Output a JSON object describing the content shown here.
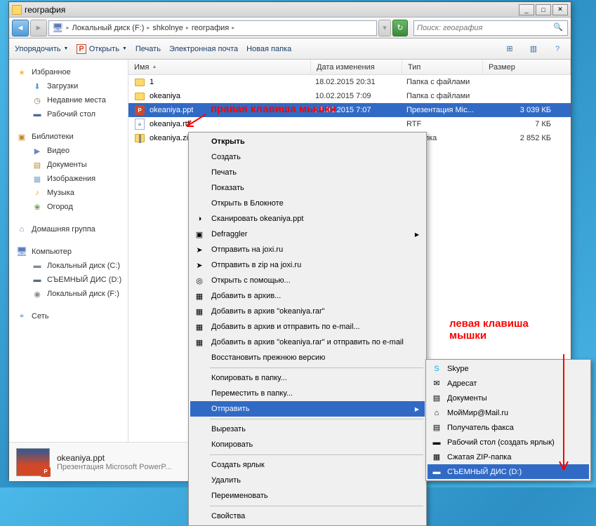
{
  "window": {
    "title": "география"
  },
  "breadcrumbs": [
    "Локальный диск (F:)",
    "shkolnye",
    "география"
  ],
  "search": {
    "placeholder": "Поиск: география"
  },
  "toolbar": {
    "organize": "Упорядочить",
    "open": "Открыть",
    "print": "Печать",
    "email": "Электронная почта",
    "newfolder": "Новая папка"
  },
  "columns": {
    "name": "Имя",
    "date": "Дата изменения",
    "type": "Тип",
    "size": "Размер"
  },
  "sidebar": {
    "favorites": {
      "label": "Избранное",
      "items": [
        "Загрузки",
        "Недавние места",
        "Рабочий стол"
      ]
    },
    "libraries": {
      "label": "Библиотеки",
      "items": [
        "Видео",
        "Документы",
        "Изображения",
        "Музыка",
        "Огород"
      ]
    },
    "homegroup": {
      "label": "Домашняя группа"
    },
    "computer": {
      "label": "Компьютер",
      "items": [
        "Локальный диск (С:)",
        "СЪЕМНЫЙ ДИС (D:)",
        "Локальный диск (F:)"
      ]
    },
    "network": {
      "label": "Сеть"
    }
  },
  "files": [
    {
      "name": "1",
      "date": "18.02.2015 20:31",
      "type": "Папка с файлами",
      "size": ""
    },
    {
      "name": "okeaniya",
      "date": "10.02.2015 7:09",
      "type": "Папка с файлами",
      "size": ""
    },
    {
      "name": "okeaniya.ppt",
      "date": "16.02.2015 7:07",
      "type": "Презентация Mic...",
      "size": "3 039 КБ"
    },
    {
      "name": "okeaniya.rtf",
      "date": "",
      "type": "RTF",
      "size": "7 КБ"
    },
    {
      "name": "okeaniya.zip",
      "date": "",
      "type": "IP-папка",
      "size": "2 852 КБ"
    }
  ],
  "context_menu": [
    {
      "label": "Открыть",
      "bold": true
    },
    {
      "label": "Создать"
    },
    {
      "label": "Печать"
    },
    {
      "label": "Показать"
    },
    {
      "label": "Открыть в Блокноте"
    },
    {
      "label": "Сканировать okeaniya.ppt",
      "icon": "◑"
    },
    {
      "label": "Defraggler",
      "icon": "▣",
      "submenu": true
    },
    {
      "label": "Отправить на joxi.ru",
      "icon": "➤"
    },
    {
      "label": "Отправить в zip на joxi.ru",
      "icon": "➤"
    },
    {
      "label": "Открыть с помощью...",
      "icon": "◎"
    },
    {
      "label": "Добавить в архив...",
      "icon": "▦"
    },
    {
      "label": "Добавить в архив \"okeaniya.rar\"",
      "icon": "▦"
    },
    {
      "label": "Добавить в архив и отправить по e-mail...",
      "icon": "▦"
    },
    {
      "label": "Добавить в архив \"okeaniya.rar\" и отправить по e-mail",
      "icon": "▦"
    },
    {
      "label": "Восстановить прежнюю версию"
    },
    {
      "sep": true
    },
    {
      "label": "Копировать в папку..."
    },
    {
      "label": "Переместить в папку..."
    },
    {
      "label": "Отправить",
      "submenu": true,
      "highlight": true
    },
    {
      "sep": true
    },
    {
      "label": "Вырезать"
    },
    {
      "label": "Копировать"
    },
    {
      "sep": true
    },
    {
      "label": "Создать ярлык"
    },
    {
      "label": "Удалить"
    },
    {
      "label": "Переименовать"
    },
    {
      "sep": true
    },
    {
      "label": "Свойства"
    }
  ],
  "sendto_menu": [
    {
      "label": "Skype",
      "icon": "S",
      "color": "#00aff0"
    },
    {
      "label": "Адресат",
      "icon": "✉"
    },
    {
      "label": "Документы",
      "icon": "▤"
    },
    {
      "label": "МойМир@Mail.ru",
      "icon": "⌂"
    },
    {
      "label": "Получатель факса",
      "icon": "▤"
    },
    {
      "label": "Рабочий стол (создать ярлык)",
      "icon": "▬"
    },
    {
      "label": "Сжатая ZIP-папка",
      "icon": "▦"
    },
    {
      "label": "СЪЕМНЫЙ ДИС (D:)",
      "icon": "▬",
      "highlight": true
    }
  ],
  "details": {
    "name": "okeaniya.ppt",
    "type": "Презентация Microsoft PowerP..."
  },
  "annotations": {
    "right_click": "правая клавиша мышки",
    "left_click": "левая клавиша мышки"
  }
}
